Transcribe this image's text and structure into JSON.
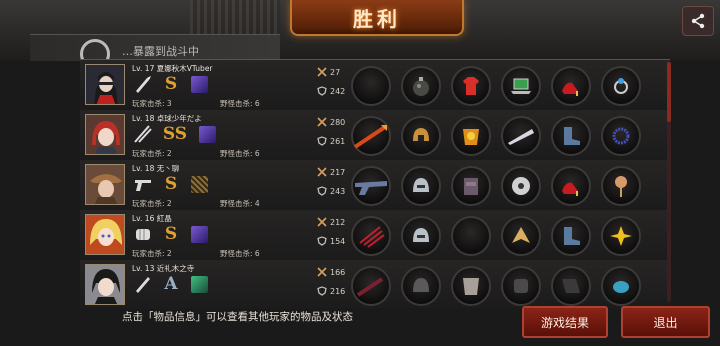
{
  "title": "胜利",
  "behind": {
    "text": "…暴露到战斗中"
  },
  "stat_icons": {
    "kills": "crossed-swords-icon",
    "defense": "shield-icon"
  },
  "players": [
    {
      "level_name": "Lv. 17 夏娜秋木VTuber",
      "weapon_icon": "knives-icon",
      "grade": "S",
      "pk": "玩家击杀: 3",
      "monster_kills": "野怪击杀: 6",
      "stat_kills": "27",
      "stat_defense": "242",
      "items": [
        "empty-slot",
        "bomb-icon",
        "red-shirt-icon",
        "laptop-icon",
        "red-heels-icon",
        "ring-icon"
      ]
    },
    {
      "level_name": "Lv. 18 卓球少年だよ",
      "weapon_icon": "twin-swords-icon",
      "grade": "SS",
      "pk": "玩家击杀: 2",
      "monster_kills": "野怪击杀: 6",
      "stat_kills": "280",
      "stat_defense": "261",
      "items": [
        "flaming-spear-icon",
        "golden-helmet-icon",
        "armor-icon",
        "silver-blade-icon",
        "boots-icon",
        "bracelet-icon"
      ]
    },
    {
      "level_name": "Lv. 18 无丶聊",
      "weapon_icon": "pistol-icon",
      "grade": "S",
      "pk": "玩家击杀: 2",
      "monster_kills": "野怪击杀: 4",
      "stat_kills": "217",
      "stat_defense": "243",
      "items": [
        "revolver-icon",
        "steel-helmet-icon",
        "vest-icon",
        "disc-icon",
        "red-heels-icon",
        "scepter-icon"
      ]
    },
    {
      "level_name": "Lv. 16 紅晶",
      "weapon_icon": "fist-icon",
      "grade": "S",
      "pk": "玩家击杀: 2",
      "monster_kills": "野怪击杀: 6",
      "stat_kills": "212",
      "stat_defense": "154",
      "items": [
        "claw-gauntlet-icon",
        "steel-helmet-icon",
        "empty-slot",
        "gold-leaf-icon",
        "boots-icon",
        "lily-icon"
      ]
    },
    {
      "level_name": "Lv. 13 近礼木之寺",
      "weapon_icon": "blade-icon",
      "grade": "A",
      "pk": "",
      "monster_kills": "",
      "stat_kills": "166",
      "stat_defense": "216",
      "items": [
        "dark-sword-icon",
        "helmet-icon",
        "cuirass-icon",
        "gauntlet-icon",
        "sleeve-icon",
        "blue-orb-icon"
      ]
    }
  ],
  "hint": "点击「物品信息」可以查看其他玩家的物品及状态",
  "buttons": {
    "results": "游戏结果",
    "exit": "退出"
  },
  "colors": {
    "accent": "#8a2418",
    "grade_gold": "#e0a030"
  }
}
